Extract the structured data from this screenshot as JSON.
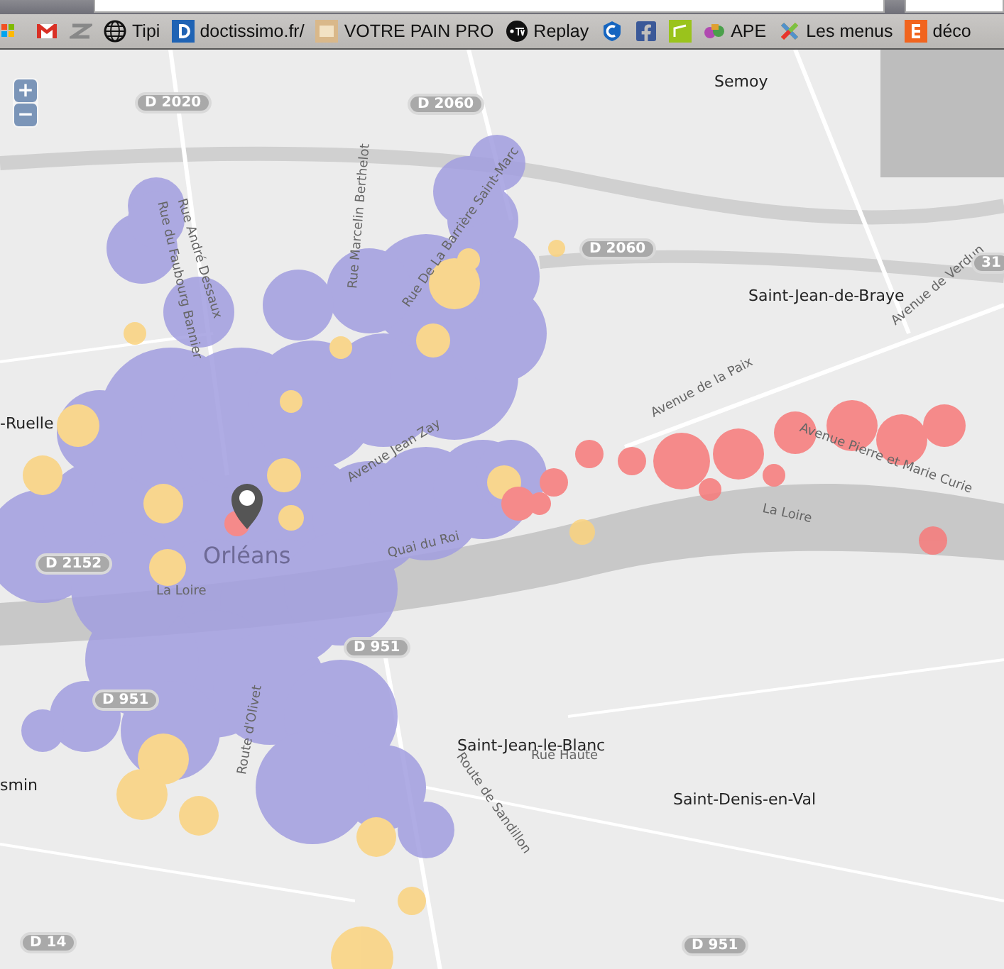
{
  "bookmarks": [
    {
      "kind": "icon"
    },
    {
      "kind": "icon"
    },
    {
      "kind": "icon"
    },
    {
      "kind": "link",
      "label": "Tipi"
    },
    {
      "kind": "link",
      "label": "doctissimo.fr/"
    },
    {
      "kind": "link",
      "label": "VOTRE PAIN PRO"
    },
    {
      "kind": "link",
      "label": "Replay"
    },
    {
      "kind": "icon"
    },
    {
      "kind": "icon"
    },
    {
      "kind": "icon"
    },
    {
      "kind": "link",
      "label": "APE"
    },
    {
      "kind": "link",
      "label": "Les menus"
    },
    {
      "kind": "link",
      "label": "déco"
    }
  ],
  "map": {
    "zoom_in": "+",
    "zoom_out": "−",
    "places": [
      {
        "kind": "town",
        "label": "Semoy"
      },
      {
        "kind": "town",
        "label": "Saint-Jean-de-Braye"
      },
      {
        "kind": "city",
        "label": "Orléans"
      },
      {
        "kind": "town",
        "label": "-Ruelle"
      },
      {
        "kind": "town",
        "label": "Saint-Jean-le-Blanc"
      },
      {
        "kind": "town",
        "label": "Saint-Denis-en-Val"
      },
      {
        "kind": "town",
        "label": "smin"
      }
    ],
    "roads": [
      "D 2020",
      "D 2060",
      "D 2060",
      "D 2152",
      "D 951",
      "D 951",
      "D 951",
      "D 14",
      "31"
    ],
    "streets": [
      "Rue André Dessaux",
      "Rue du Faubourg Bannier",
      "Rue Marcelin Berthelot",
      "Rue De La Barrière Saint-Marc",
      "Avenue de Verdun",
      "Avenue de la Paix",
      "Avenue Pierre et Marie Curie",
      "Quai du Roi",
      "La Loire",
      "La Loire",
      "Avenue Jean Zay",
      "Route d'Olivet",
      "Route de Sandillon",
      "Rue Haute"
    ]
  }
}
